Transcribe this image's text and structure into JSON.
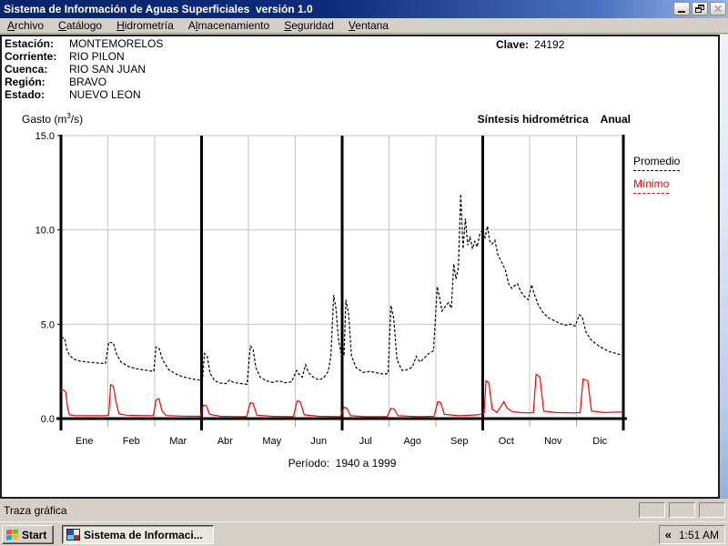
{
  "window": {
    "title": "Sistema de Información de Aguas Superficiales  versión 1.0",
    "controls": {
      "minimize": "minimize",
      "restore": "restore",
      "close": "close (disabled)"
    }
  },
  "menu_bar": {
    "items": [
      {
        "label": "Archivo",
        "underline": 0
      },
      {
        "label": "Catálogo",
        "underline": 0
      },
      {
        "label": "Hidrometría",
        "underline": 0
      },
      {
        "label": "Almacenamiento",
        "underline": 1
      },
      {
        "label": "Seguridad",
        "underline": 0
      },
      {
        "label": "Ventana",
        "underline": 0
      }
    ]
  },
  "station_info": {
    "rows": [
      {
        "label": "Estación:",
        "value": "MONTEMORELOS"
      },
      {
        "label": "Corriente:",
        "value": "RIO PILON"
      },
      {
        "label": "Cuenca:",
        "value": "RIO SAN JUAN"
      },
      {
        "label": "Región:",
        "value": "BRAVO"
      },
      {
        "label": "Estado:",
        "value": "NUEVO LEON"
      }
    ],
    "clave_label": "Clave:",
    "clave_value": "24192"
  },
  "chart_header": {
    "y_axis_title_prefix": "Gasto (m",
    "y_axis_title_sup": "3",
    "y_axis_title_suffix": "/s)",
    "subtitle_left": "Síntesis hidrométrica",
    "subtitle_right": "Anual"
  },
  "chart_data": {
    "type": "line",
    "title": "Síntesis hidrométrica Anual",
    "ylabel": "Gasto (m³/s)",
    "ylim": [
      0,
      15
    ],
    "yticks": [
      {
        "value": 0,
        "label": "0.0"
      },
      {
        "value": 5,
        "label": "5.0"
      },
      {
        "value": 10,
        "label": "10.0"
      },
      {
        "value": 15,
        "label": "15.0"
      }
    ],
    "categories": [
      "Ene",
      "Feb",
      "Mar",
      "Abr",
      "May",
      "Jun",
      "Jul",
      "Ago",
      "Sep",
      "Oct",
      "Nov",
      "Dic"
    ],
    "x_unit": "month fraction 0-12 (day of year)",
    "quarter_divider_months": [
      3,
      6,
      9
    ],
    "grid": "horizontal at 5/10/15, vertical at each month boundary",
    "legend_position": "outside top-right",
    "period_label": "Período:  1940 a 1999",
    "legend": [
      {
        "label": "Promedio",
        "color": "#000000",
        "style": "dashed"
      },
      {
        "label": "Mínimo",
        "color": "#ff0000",
        "style": "solid"
      }
    ],
    "series": [
      {
        "name": "Promedio",
        "color": "#000000",
        "style": "dashed",
        "points": [
          [
            0.0,
            4.3
          ],
          [
            0.08,
            4.25
          ],
          [
            0.12,
            3.7
          ],
          [
            0.18,
            3.35
          ],
          [
            0.28,
            3.15
          ],
          [
            0.4,
            3.05
          ],
          [
            0.55,
            3.0
          ],
          [
            0.75,
            2.95
          ],
          [
            0.95,
            2.92
          ],
          [
            1.02,
            4.05
          ],
          [
            1.12,
            4.0
          ],
          [
            1.18,
            3.45
          ],
          [
            1.28,
            3.0
          ],
          [
            1.45,
            2.75
          ],
          [
            1.65,
            2.62
          ],
          [
            1.85,
            2.55
          ],
          [
            1.98,
            2.5
          ],
          [
            2.03,
            3.8
          ],
          [
            2.1,
            3.7
          ],
          [
            2.17,
            3.1
          ],
          [
            2.3,
            2.6
          ],
          [
            2.5,
            2.3
          ],
          [
            2.7,
            2.15
          ],
          [
            2.9,
            2.06
          ],
          [
            2.98,
            2.04
          ],
          [
            3.02,
            2.0
          ],
          [
            3.06,
            3.45
          ],
          [
            3.12,
            3.3
          ],
          [
            3.18,
            2.4
          ],
          [
            3.28,
            2.0
          ],
          [
            3.4,
            1.88
          ],
          [
            3.52,
            1.85
          ],
          [
            3.6,
            2.05
          ],
          [
            3.68,
            1.92
          ],
          [
            3.82,
            1.86
          ],
          [
            3.97,
            1.82
          ],
          [
            4.04,
            3.85
          ],
          [
            4.1,
            3.7
          ],
          [
            4.16,
            2.7
          ],
          [
            4.25,
            2.2
          ],
          [
            4.38,
            2.0
          ],
          [
            4.52,
            1.92
          ],
          [
            4.65,
            2.0
          ],
          [
            4.78,
            1.9
          ],
          [
            4.92,
            1.95
          ],
          [
            5.03,
            2.55
          ],
          [
            5.08,
            2.35
          ],
          [
            5.15,
            2.2
          ],
          [
            5.22,
            2.85
          ],
          [
            5.28,
            2.45
          ],
          [
            5.38,
            2.2
          ],
          [
            5.5,
            2.05
          ],
          [
            5.6,
            2.15
          ],
          [
            5.7,
            2.5
          ],
          [
            5.76,
            3.3
          ],
          [
            5.82,
            6.55
          ],
          [
            5.87,
            5.8
          ],
          [
            5.92,
            4.2
          ],
          [
            5.97,
            3.5
          ],
          [
            6.04,
            3.4
          ],
          [
            6.08,
            6.3
          ],
          [
            6.14,
            5.5
          ],
          [
            6.2,
            3.3
          ],
          [
            6.3,
            2.7
          ],
          [
            6.45,
            2.45
          ],
          [
            6.6,
            2.5
          ],
          [
            6.75,
            2.42
          ],
          [
            6.9,
            2.35
          ],
          [
            6.98,
            2.4
          ],
          [
            7.04,
            6.0
          ],
          [
            7.1,
            5.3
          ],
          [
            7.17,
            3.1
          ],
          [
            7.28,
            2.55
          ],
          [
            7.4,
            2.6
          ],
          [
            7.5,
            2.75
          ],
          [
            7.58,
            3.3
          ],
          [
            7.66,
            3.0
          ],
          [
            7.75,
            3.2
          ],
          [
            7.85,
            3.45
          ],
          [
            7.95,
            3.6
          ],
          [
            8.03,
            7.0
          ],
          [
            8.08,
            6.4
          ],
          [
            8.13,
            5.7
          ],
          [
            8.2,
            5.95
          ],
          [
            8.27,
            6.15
          ],
          [
            8.33,
            5.85
          ],
          [
            8.38,
            8.2
          ],
          [
            8.43,
            7.4
          ],
          [
            8.48,
            8.0
          ],
          [
            8.53,
            11.9
          ],
          [
            8.58,
            9.0
          ],
          [
            8.63,
            10.6
          ],
          [
            8.68,
            9.2
          ],
          [
            8.73,
            9.6
          ],
          [
            8.78,
            9.0
          ],
          [
            8.83,
            9.4
          ],
          [
            8.88,
            9.1
          ],
          [
            8.94,
            9.8
          ],
          [
            9.0,
            10.0
          ],
          [
            9.05,
            9.6
          ],
          [
            9.1,
            10.2
          ],
          [
            9.15,
            9.4
          ],
          [
            9.2,
            9.25
          ],
          [
            9.26,
            9.45
          ],
          [
            9.32,
            8.7
          ],
          [
            9.4,
            8.3
          ],
          [
            9.48,
            7.9
          ],
          [
            9.56,
            7.1
          ],
          [
            9.62,
            6.9
          ],
          [
            9.68,
            7.05
          ],
          [
            9.74,
            7.15
          ],
          [
            9.82,
            6.7
          ],
          [
            9.9,
            6.45
          ],
          [
            9.97,
            6.3
          ],
          [
            10.04,
            7.1
          ],
          [
            10.1,
            6.6
          ],
          [
            10.18,
            6.05
          ],
          [
            10.28,
            5.65
          ],
          [
            10.4,
            5.35
          ],
          [
            10.52,
            5.2
          ],
          [
            10.64,
            5.05
          ],
          [
            10.76,
            4.95
          ],
          [
            10.88,
            5.0
          ],
          [
            10.97,
            4.9
          ],
          [
            11.06,
            5.5
          ],
          [
            11.12,
            5.4
          ],
          [
            11.2,
            4.6
          ],
          [
            11.3,
            4.2
          ],
          [
            11.42,
            3.95
          ],
          [
            11.55,
            3.75
          ],
          [
            11.7,
            3.55
          ],
          [
            11.85,
            3.45
          ],
          [
            11.98,
            3.35
          ]
        ]
      },
      {
        "name": "Mínimo",
        "color": "#ff0000",
        "style": "solid",
        "points": [
          [
            0.0,
            1.55
          ],
          [
            0.06,
            1.5
          ],
          [
            0.1,
            1.4
          ],
          [
            0.14,
            0.6
          ],
          [
            0.18,
            0.2
          ],
          [
            0.3,
            0.16
          ],
          [
            0.6,
            0.15
          ],
          [
            0.95,
            0.15
          ],
          [
            1.02,
            0.2
          ],
          [
            1.06,
            1.8
          ],
          [
            1.12,
            1.7
          ],
          [
            1.18,
            0.8
          ],
          [
            1.24,
            0.25
          ],
          [
            1.4,
            0.18
          ],
          [
            1.7,
            0.16
          ],
          [
            1.97,
            0.15
          ],
          [
            2.03,
            1.0
          ],
          [
            2.09,
            1.05
          ],
          [
            2.16,
            0.4
          ],
          [
            2.24,
            0.16
          ],
          [
            2.6,
            0.13
          ],
          [
            2.97,
            0.12
          ],
          [
            3.04,
            0.72
          ],
          [
            3.1,
            0.68
          ],
          [
            3.17,
            0.22
          ],
          [
            3.4,
            0.12
          ],
          [
            3.96,
            0.1
          ],
          [
            4.04,
            0.85
          ],
          [
            4.1,
            0.8
          ],
          [
            4.18,
            0.18
          ],
          [
            4.5,
            0.12
          ],
          [
            4.96,
            0.1
          ],
          [
            5.04,
            0.95
          ],
          [
            5.11,
            0.88
          ],
          [
            5.19,
            0.2
          ],
          [
            5.5,
            0.12
          ],
          [
            5.96,
            0.1
          ],
          [
            6.04,
            0.6
          ],
          [
            6.1,
            0.56
          ],
          [
            6.18,
            0.15
          ],
          [
            6.5,
            0.1
          ],
          [
            6.96,
            0.1
          ],
          [
            7.04,
            0.55
          ],
          [
            7.11,
            0.5
          ],
          [
            7.19,
            0.15
          ],
          [
            7.6,
            0.1
          ],
          [
            7.96,
            0.12
          ],
          [
            8.04,
            0.9
          ],
          [
            8.1,
            0.85
          ],
          [
            8.18,
            0.22
          ],
          [
            8.5,
            0.15
          ],
          [
            8.9,
            0.2
          ],
          [
            8.97,
            0.25
          ],
          [
            9.03,
            0.3
          ],
          [
            9.07,
            2.0
          ],
          [
            9.13,
            1.9
          ],
          [
            9.2,
            0.5
          ],
          [
            9.3,
            0.32
          ],
          [
            9.45,
            0.9
          ],
          [
            9.52,
            0.55
          ],
          [
            9.62,
            0.38
          ],
          [
            9.8,
            0.32
          ],
          [
            9.97,
            0.3
          ],
          [
            10.08,
            0.32
          ],
          [
            10.14,
            2.35
          ],
          [
            10.22,
            2.2
          ],
          [
            10.3,
            0.4
          ],
          [
            10.55,
            0.32
          ],
          [
            10.95,
            0.3
          ],
          [
            11.08,
            0.32
          ],
          [
            11.14,
            2.1
          ],
          [
            11.24,
            2.0
          ],
          [
            11.32,
            0.4
          ],
          [
            11.6,
            0.32
          ],
          [
            11.98,
            0.35
          ]
        ]
      }
    ]
  },
  "status_bar": {
    "text": "Traza gráfica",
    "panel_count": 3
  },
  "taskbar": {
    "start_label": "Start",
    "task_button_label": "Sistema de Informaci...",
    "tray_chevron": "«",
    "clock": "1:51 AM"
  },
  "colors": {
    "titlebar_left": "#0a246a",
    "titlebar_right": "#9cb7e8",
    "chrome": "#d4d0c8",
    "promedio": "#000000",
    "minimo": "#ff0000"
  }
}
